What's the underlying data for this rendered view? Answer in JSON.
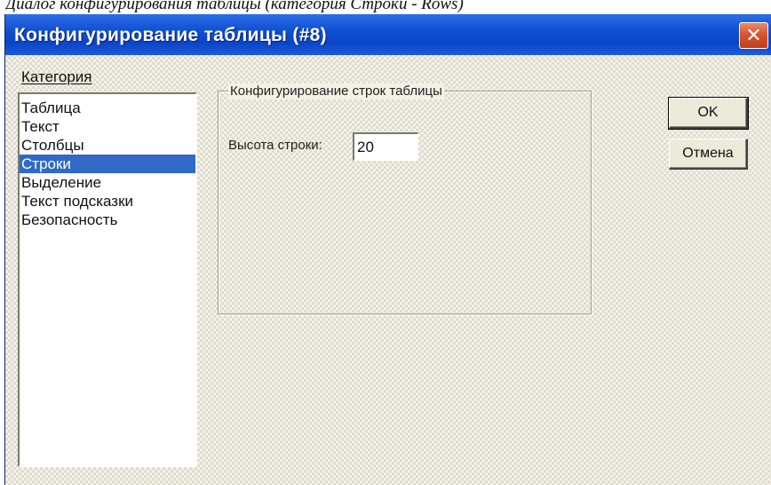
{
  "caption": "Диалог конфигурирования таблицы (категория Строки - Rows)",
  "window": {
    "title": "Конфигурирование таблицы (#8)",
    "close_icon": "close-icon"
  },
  "category": {
    "label": "Категория",
    "items": [
      {
        "label": "Таблица"
      },
      {
        "label": "Текст"
      },
      {
        "label": "Столбцы"
      },
      {
        "label": "Строки"
      },
      {
        "label": "Выделение"
      },
      {
        "label": "Текст подсказки"
      },
      {
        "label": "Безопасность"
      }
    ],
    "selected": "Строки"
  },
  "group": {
    "title": "Конфигурирование строк таблицы",
    "row_height_label": "Высота строки:",
    "row_height_value": "20"
  },
  "buttons": {
    "ok_label": "OK",
    "cancel_label": "Отмена"
  },
  "colors": {
    "titlebar": "#0a45c7",
    "selection": "#316ac5",
    "close_button": "#d9542f"
  }
}
